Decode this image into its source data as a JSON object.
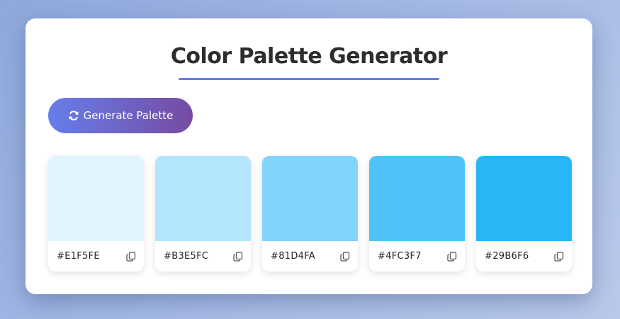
{
  "app": {
    "title": "Color Palette Generator"
  },
  "colors": {
    "accent": "#667eea",
    "button_gradient_start": "#667eea",
    "button_gradient_end": "#764ba2"
  },
  "generate_button": {
    "label": "Generate Palette",
    "icon": "refresh-icon"
  },
  "palette": [
    {
      "hex": "#E1F5FE",
      "icon": "copy-icon"
    },
    {
      "hex": "#B3E5FC",
      "icon": "copy-icon"
    },
    {
      "hex": "#81D4FA",
      "icon": "copy-icon"
    },
    {
      "hex": "#4FC3F7",
      "icon": "copy-icon"
    },
    {
      "hex": "#29B6F6",
      "icon": "copy-icon"
    }
  ]
}
